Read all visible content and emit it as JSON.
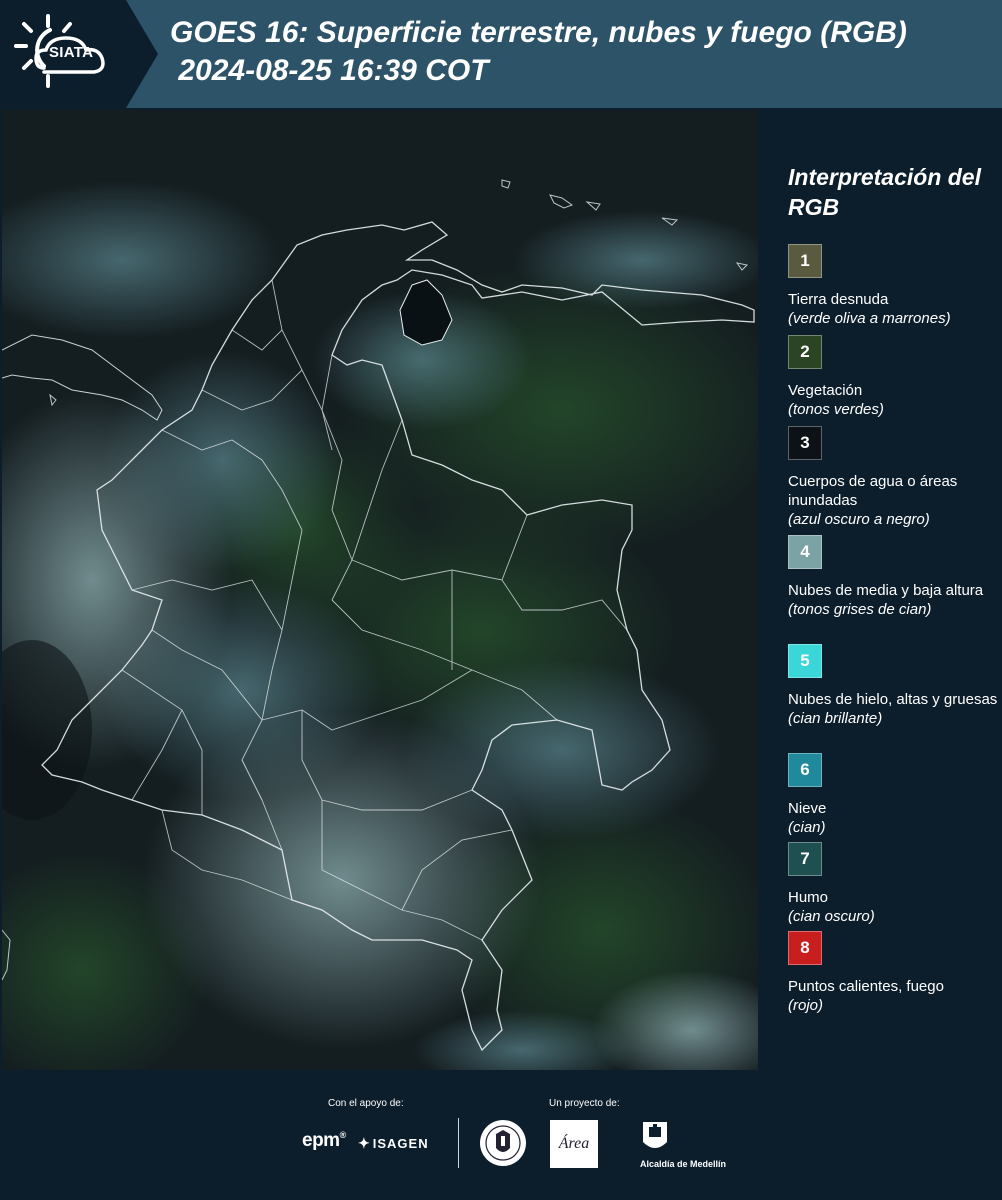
{
  "header": {
    "logo_text": "SIATA",
    "title_line1": "GOES 16: Superficie terrestre, nubes y fuego (RGB)",
    "title_line2": " 2024-08-25 16:39 COT"
  },
  "legend": {
    "title": "Interpretación del RGB",
    "items": [
      {
        "number": "1",
        "label": "Tierra desnuda",
        "note": "(verde oliva a marrones)",
        "color": "#5a5a40"
      },
      {
        "number": "2",
        "label": "Vegetación",
        "note": "(tonos verdes)",
        "color": "#2b4524"
      },
      {
        "number": "3",
        "label": "Cuerpos de agua o áreas inundadas",
        "note": "(azul oscuro a negro)",
        "color": "#0c1218"
      },
      {
        "number": "4",
        "label": "Nubes de media y baja altura",
        "note": "(tonos grises de cian)",
        "color": "#7ba3a6"
      },
      {
        "number": "5",
        "label": "Nubes de hielo, altas y gruesas",
        "note": "(cian brillante)",
        "color": "#3ad6d8"
      },
      {
        "number": "6",
        "label": "Nieve",
        "note": "(cian)",
        "color": "#21899c"
      },
      {
        "number": "7",
        "label": "Humo",
        "note": "(cian oscuro)",
        "color": "#1e4f51"
      },
      {
        "number": "8",
        "label": "Puntos calientes, fuego",
        "note": "(rojo)",
        "color": "#c81e1e"
      }
    ]
  },
  "footer": {
    "support_label": "Con el apoyo de:",
    "project_label": "Un proyecto de:",
    "sponsors": [
      "epm",
      "ISAGEN"
    ],
    "partners": [
      "Área Metropolitana Valle de Aburrá",
      "Alcaldía de Medellín"
    ],
    "alcaldia_label": "Alcaldía de Medellín"
  },
  "icons": [
    "siata-logo-icon",
    "epm-logo-icon",
    "isagen-logo-icon",
    "seal-icon",
    "area-metropolitana-logo-icon",
    "alcaldia-logo-icon"
  ]
}
